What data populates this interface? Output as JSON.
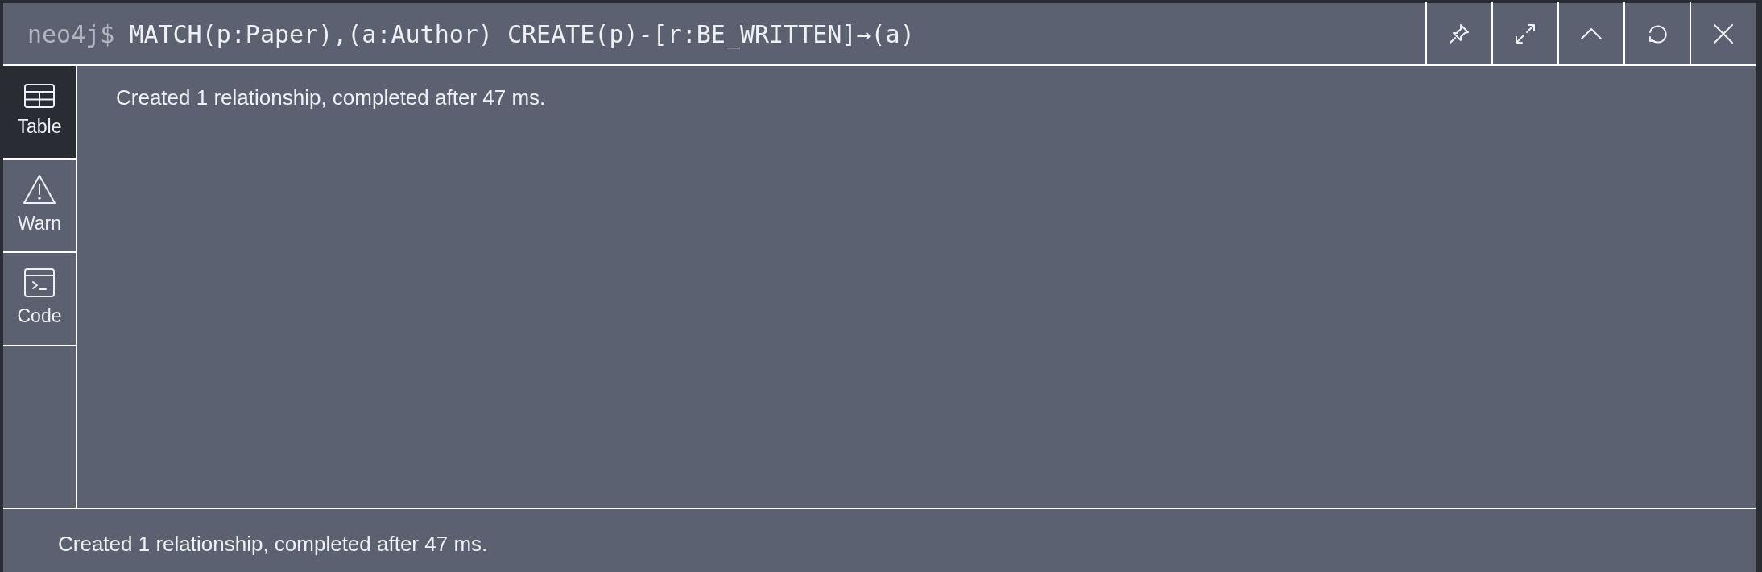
{
  "header": {
    "prompt": "neo4j$",
    "query": "MATCH(p:Paper),(a:Author) CREATE(p)-[r:BE_WRITTEN]→(a)",
    "buttons": [
      {
        "kind": "pin"
      },
      {
        "kind": "expand"
      },
      {
        "kind": "collapse"
      },
      {
        "kind": "rerun"
      },
      {
        "kind": "close"
      }
    ]
  },
  "sidebar": {
    "items": [
      {
        "label": "Table",
        "kind": "table",
        "selected": true
      },
      {
        "label": "Warn",
        "kind": "warn",
        "selected": false
      },
      {
        "label": "Code",
        "kind": "code",
        "selected": false
      }
    ]
  },
  "result": {
    "message": "Created 1 relationship, completed after 47 ms."
  },
  "status_bar": {
    "message": "Created 1 relationship, completed after 47 ms."
  }
}
